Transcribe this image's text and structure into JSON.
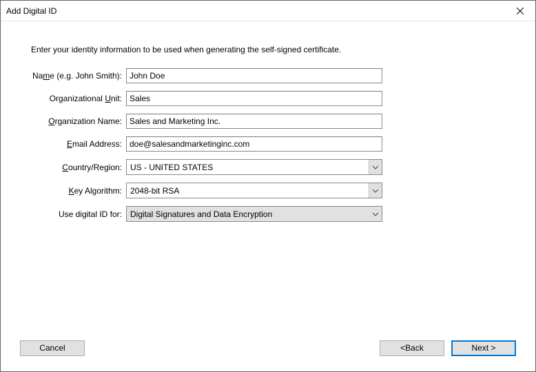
{
  "window": {
    "title": "Add Digital ID"
  },
  "intro": "Enter your identity information to be used when generating the self-signed certificate.",
  "labels": {
    "name_pre": "Na",
    "name_u": "m",
    "name_post": "e (e.g. John Smith):",
    "org_unit_pre": "Organizational ",
    "org_unit_u": "U",
    "org_unit_post": "nit:",
    "org_name_u": "O",
    "org_name_post": "rganization Name:",
    "email_u": "E",
    "email_post": "mail Address:",
    "country_u": "C",
    "country_post": "ountry/Region:",
    "key_u": "K",
    "key_post": "ey Algorithm:",
    "use": "Use digital ID for:"
  },
  "fields": {
    "name": "John Doe",
    "org_unit": "Sales",
    "org_name": "Sales and Marketing Inc.",
    "email": "doe@salesandmarketinginc.com",
    "country": "US - UNITED STATES",
    "key_algorithm": "2048-bit RSA",
    "use_for": "Digital Signatures and Data Encryption"
  },
  "buttons": {
    "cancel": "Cancel",
    "back_pre": "< ",
    "back_u": "B",
    "back_post": "ack",
    "next": "Next >"
  }
}
